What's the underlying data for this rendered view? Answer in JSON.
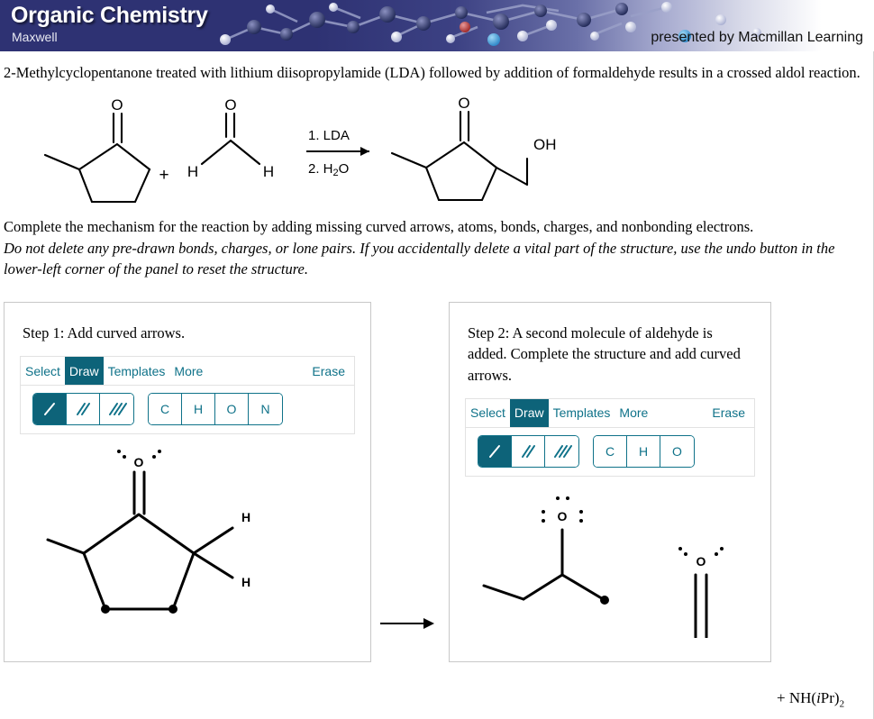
{
  "header": {
    "title": "Organic Chemistry",
    "author": "Maxwell",
    "presented_by": "presented by Macmillan Learning",
    "banner_color": "#2e3273",
    "banner_text_color": "#ffffff"
  },
  "intro_text": "2-Methylcyclopentanone treated with lithium diisopropylamide (LDA) followed by addition of formaldehyde results in a crossed aldol reaction.",
  "instructions": {
    "line1": "Complete the mechanism for the reaction by adding missing curved arrows, atoms, bonds, charges, and nonbonding electrons.",
    "line2": "Do not delete any pre-drawn bonds, charges, or lone pairs. If you accidentally delete a vital part of the structure, use the undo button in the lower-left corner of the panel to reset the structure."
  },
  "reaction_scheme": {
    "reactant_1_name": "2-methylcyclopentanone",
    "plus_sign": "+",
    "reactant_2_name": "formaldehyde",
    "reactant_2_labels": {
      "oxygen": "O",
      "h_left": "H",
      "h_right": "H"
    },
    "reactant_1_labels": {
      "oxygen": "O"
    },
    "conditions_above": "1. LDA",
    "conditions_below": "2. H₂O",
    "product_labels": {
      "oxygen": "O",
      "hydroxyl": "OH"
    }
  },
  "accent": {
    "teal": "#0f7289",
    "teal_dark": "#0d6379",
    "panel_border": "#c8c8c8",
    "toolbar_border": "#e2e2e2"
  },
  "panels": [
    {
      "id": "step-1",
      "title": "Step 1: Add curved arrows.",
      "toolbar": {
        "tabs": [
          {
            "label": "Select",
            "active": false
          },
          {
            "label": "Draw",
            "active": true
          },
          {
            "label": "Templates",
            "active": false
          },
          {
            "label": "More",
            "active": false
          }
        ],
        "erase_label": "Erase",
        "bond_tools": [
          {
            "name": "single-bond",
            "active": true
          },
          {
            "name": "double-bond",
            "active": false
          },
          {
            "name": "triple-bond",
            "active": false
          }
        ],
        "element_buttons": [
          "C",
          "H",
          "O",
          "N"
        ]
      },
      "molecule": {
        "name": "2-methylcyclopentanone-with-explicit-hydrogens",
        "oxygen_label": "O",
        "hydrogen_top_label": "H",
        "hydrogen_bottom_label": "H",
        "lone_pairs": 2
      }
    },
    {
      "id": "step-2",
      "title": "Step 2: A second molecule of aldehyde is added. Complete the structure and add curved arrows.",
      "toolbar": {
        "tabs": [
          {
            "label": "Select",
            "active": false
          },
          {
            "label": "Draw",
            "active": true
          },
          {
            "label": "Templates",
            "active": false
          },
          {
            "label": "More",
            "active": false
          }
        ],
        "erase_label": "Erase",
        "bond_tools": [
          {
            "name": "single-bond",
            "active": true
          },
          {
            "name": "double-bond",
            "active": false
          },
          {
            "name": "triple-bond",
            "active": false
          }
        ],
        "element_buttons": [
          "C",
          "H",
          "O"
        ]
      },
      "molecule": {
        "name": "enolate-and-formaldehyde",
        "enolate_oxygen_label": "O",
        "enolate_lone_pairs": 3,
        "aldehyde_oxygen_label": "O",
        "aldehyde_lone_pairs": 2
      }
    }
  ],
  "mid_arrow": {
    "name": "reaction-arrow"
  },
  "byproduct": {
    "plus": "+",
    "formula_prefix": "NH(",
    "formula_italic": "i",
    "formula_mid": "Pr)",
    "formula_sub": "2"
  }
}
